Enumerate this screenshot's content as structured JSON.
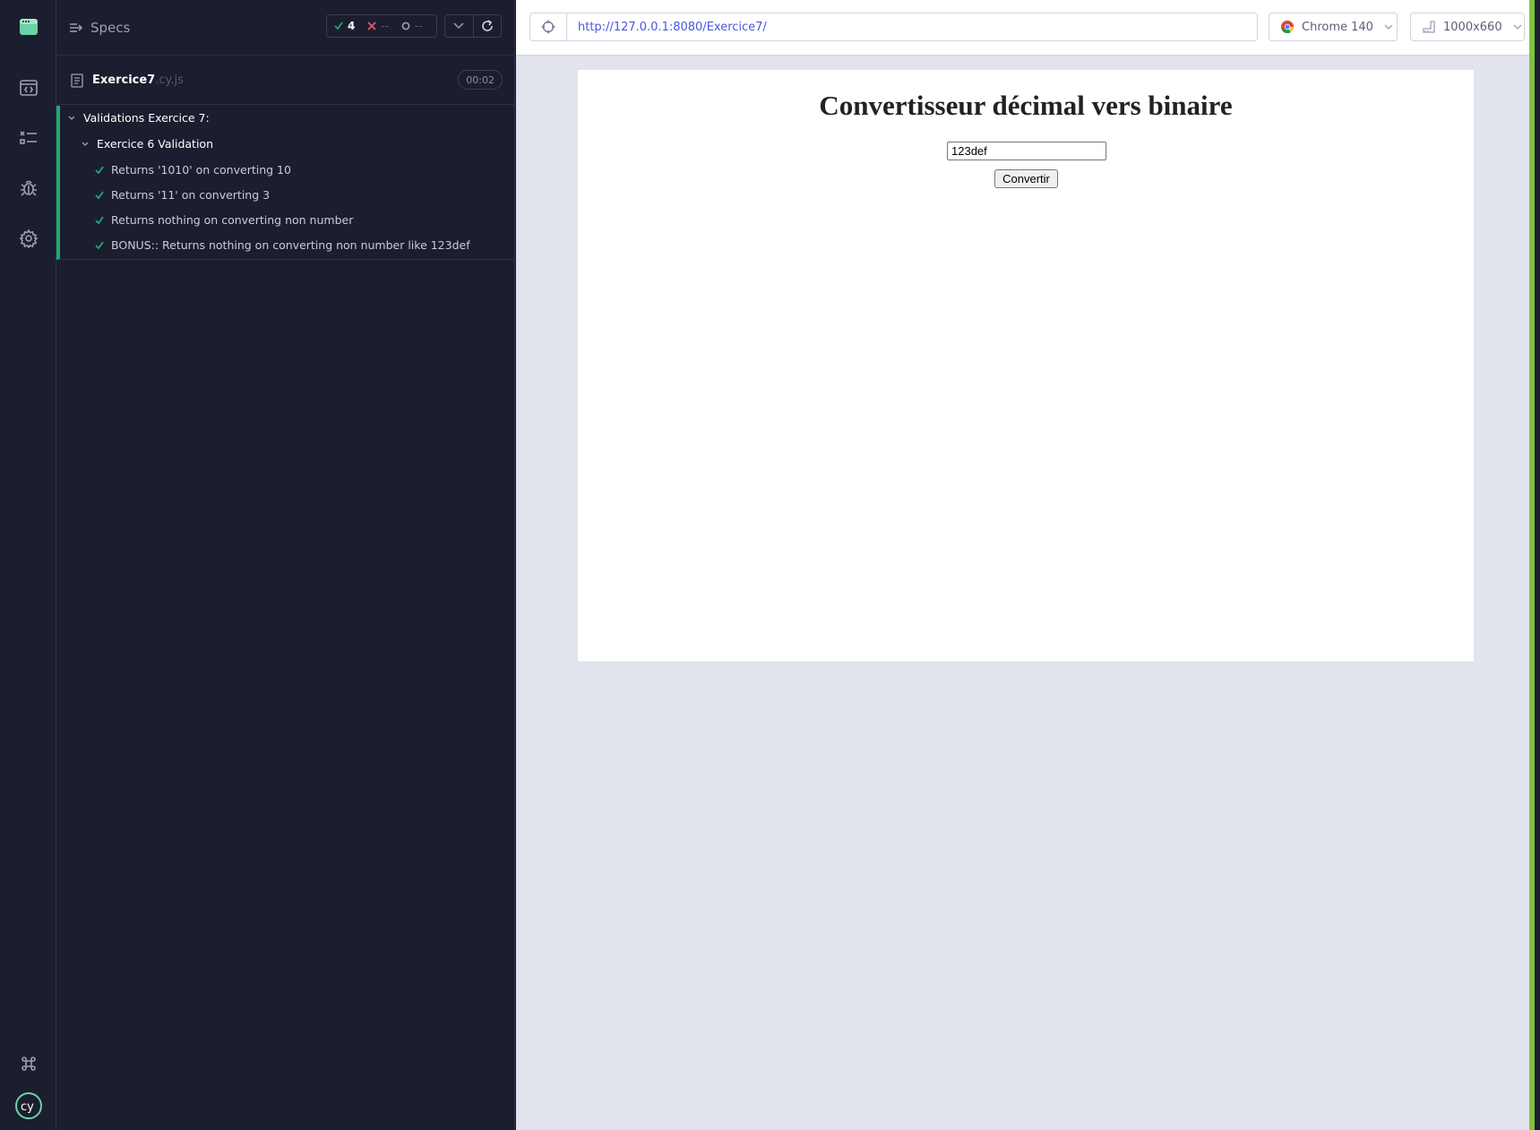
{
  "rail": {
    "items": [
      "app-logo-icon",
      "specs-list-icon",
      "runs-icon",
      "debug-icon",
      "settings-icon"
    ],
    "footer": [
      "keyboard-shortcuts-icon",
      "cypress-logo-icon"
    ]
  },
  "reporter": {
    "specs_label": "Specs",
    "stats": {
      "passed": "4",
      "failed": "--",
      "pending": "--"
    },
    "spec": {
      "name": "Exercice7",
      "ext": ".cy.js",
      "duration": "00:02"
    },
    "suites": [
      {
        "title": "Validations Exercice 7:"
      },
      {
        "title": "Exercice 6 Validation"
      }
    ],
    "tests": [
      {
        "title": "Returns '1010' on converting 10",
        "state": "passed"
      },
      {
        "title": "Returns '11' on converting 3",
        "state": "passed"
      },
      {
        "title": "Returns nothing on converting non number",
        "state": "passed"
      },
      {
        "title": "BONUS:: Returns nothing on converting non number like 123def",
        "state": "passed"
      }
    ]
  },
  "browser": {
    "url": "http://127.0.0.1:8080/Exercice7/",
    "browser_name": "Chrome 140",
    "viewport": "1000x660"
  },
  "app": {
    "title": "Convertisseur décimal vers binaire",
    "input_value": "123def",
    "button_label": "Convertir"
  },
  "colors": {
    "pass": "#1fa971",
    "fail": "#e45770",
    "url": "#4956e3",
    "accent_bar": "#7ec43d"
  }
}
